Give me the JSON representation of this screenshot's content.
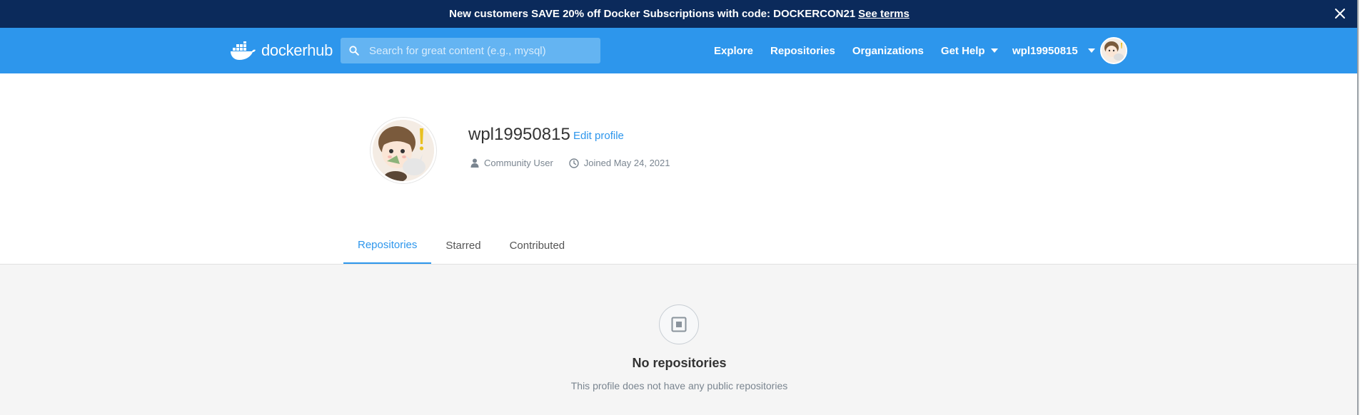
{
  "banner": {
    "text": "New customers SAVE 20% off Docker Subscriptions with code: DOCKERCON21",
    "link": "See terms"
  },
  "nav": {
    "logo_docker": "docker",
    "logo_hub": "hub",
    "search_placeholder": "Search for great content (e.g., mysql)",
    "links": [
      "Explore",
      "Repositories",
      "Organizations",
      "Get Help"
    ],
    "username": "wpl19950815"
  },
  "profile": {
    "username": "wpl19950815",
    "edit_label": "Edit profile",
    "role": "Community User",
    "joined": "Joined May 24, 2021",
    "tabs": [
      "Repositories",
      "Starred",
      "Contributed"
    ],
    "active_tab": "Repositories"
  },
  "empty_state": {
    "title": "No repositories",
    "subtitle": "This profile does not have any public repositories",
    "icon": "repository-box-icon"
  },
  "colors": {
    "banner_bg": "#0b2a5b",
    "nav_bg": "#2d96ec",
    "accent": "#2d96ec"
  }
}
